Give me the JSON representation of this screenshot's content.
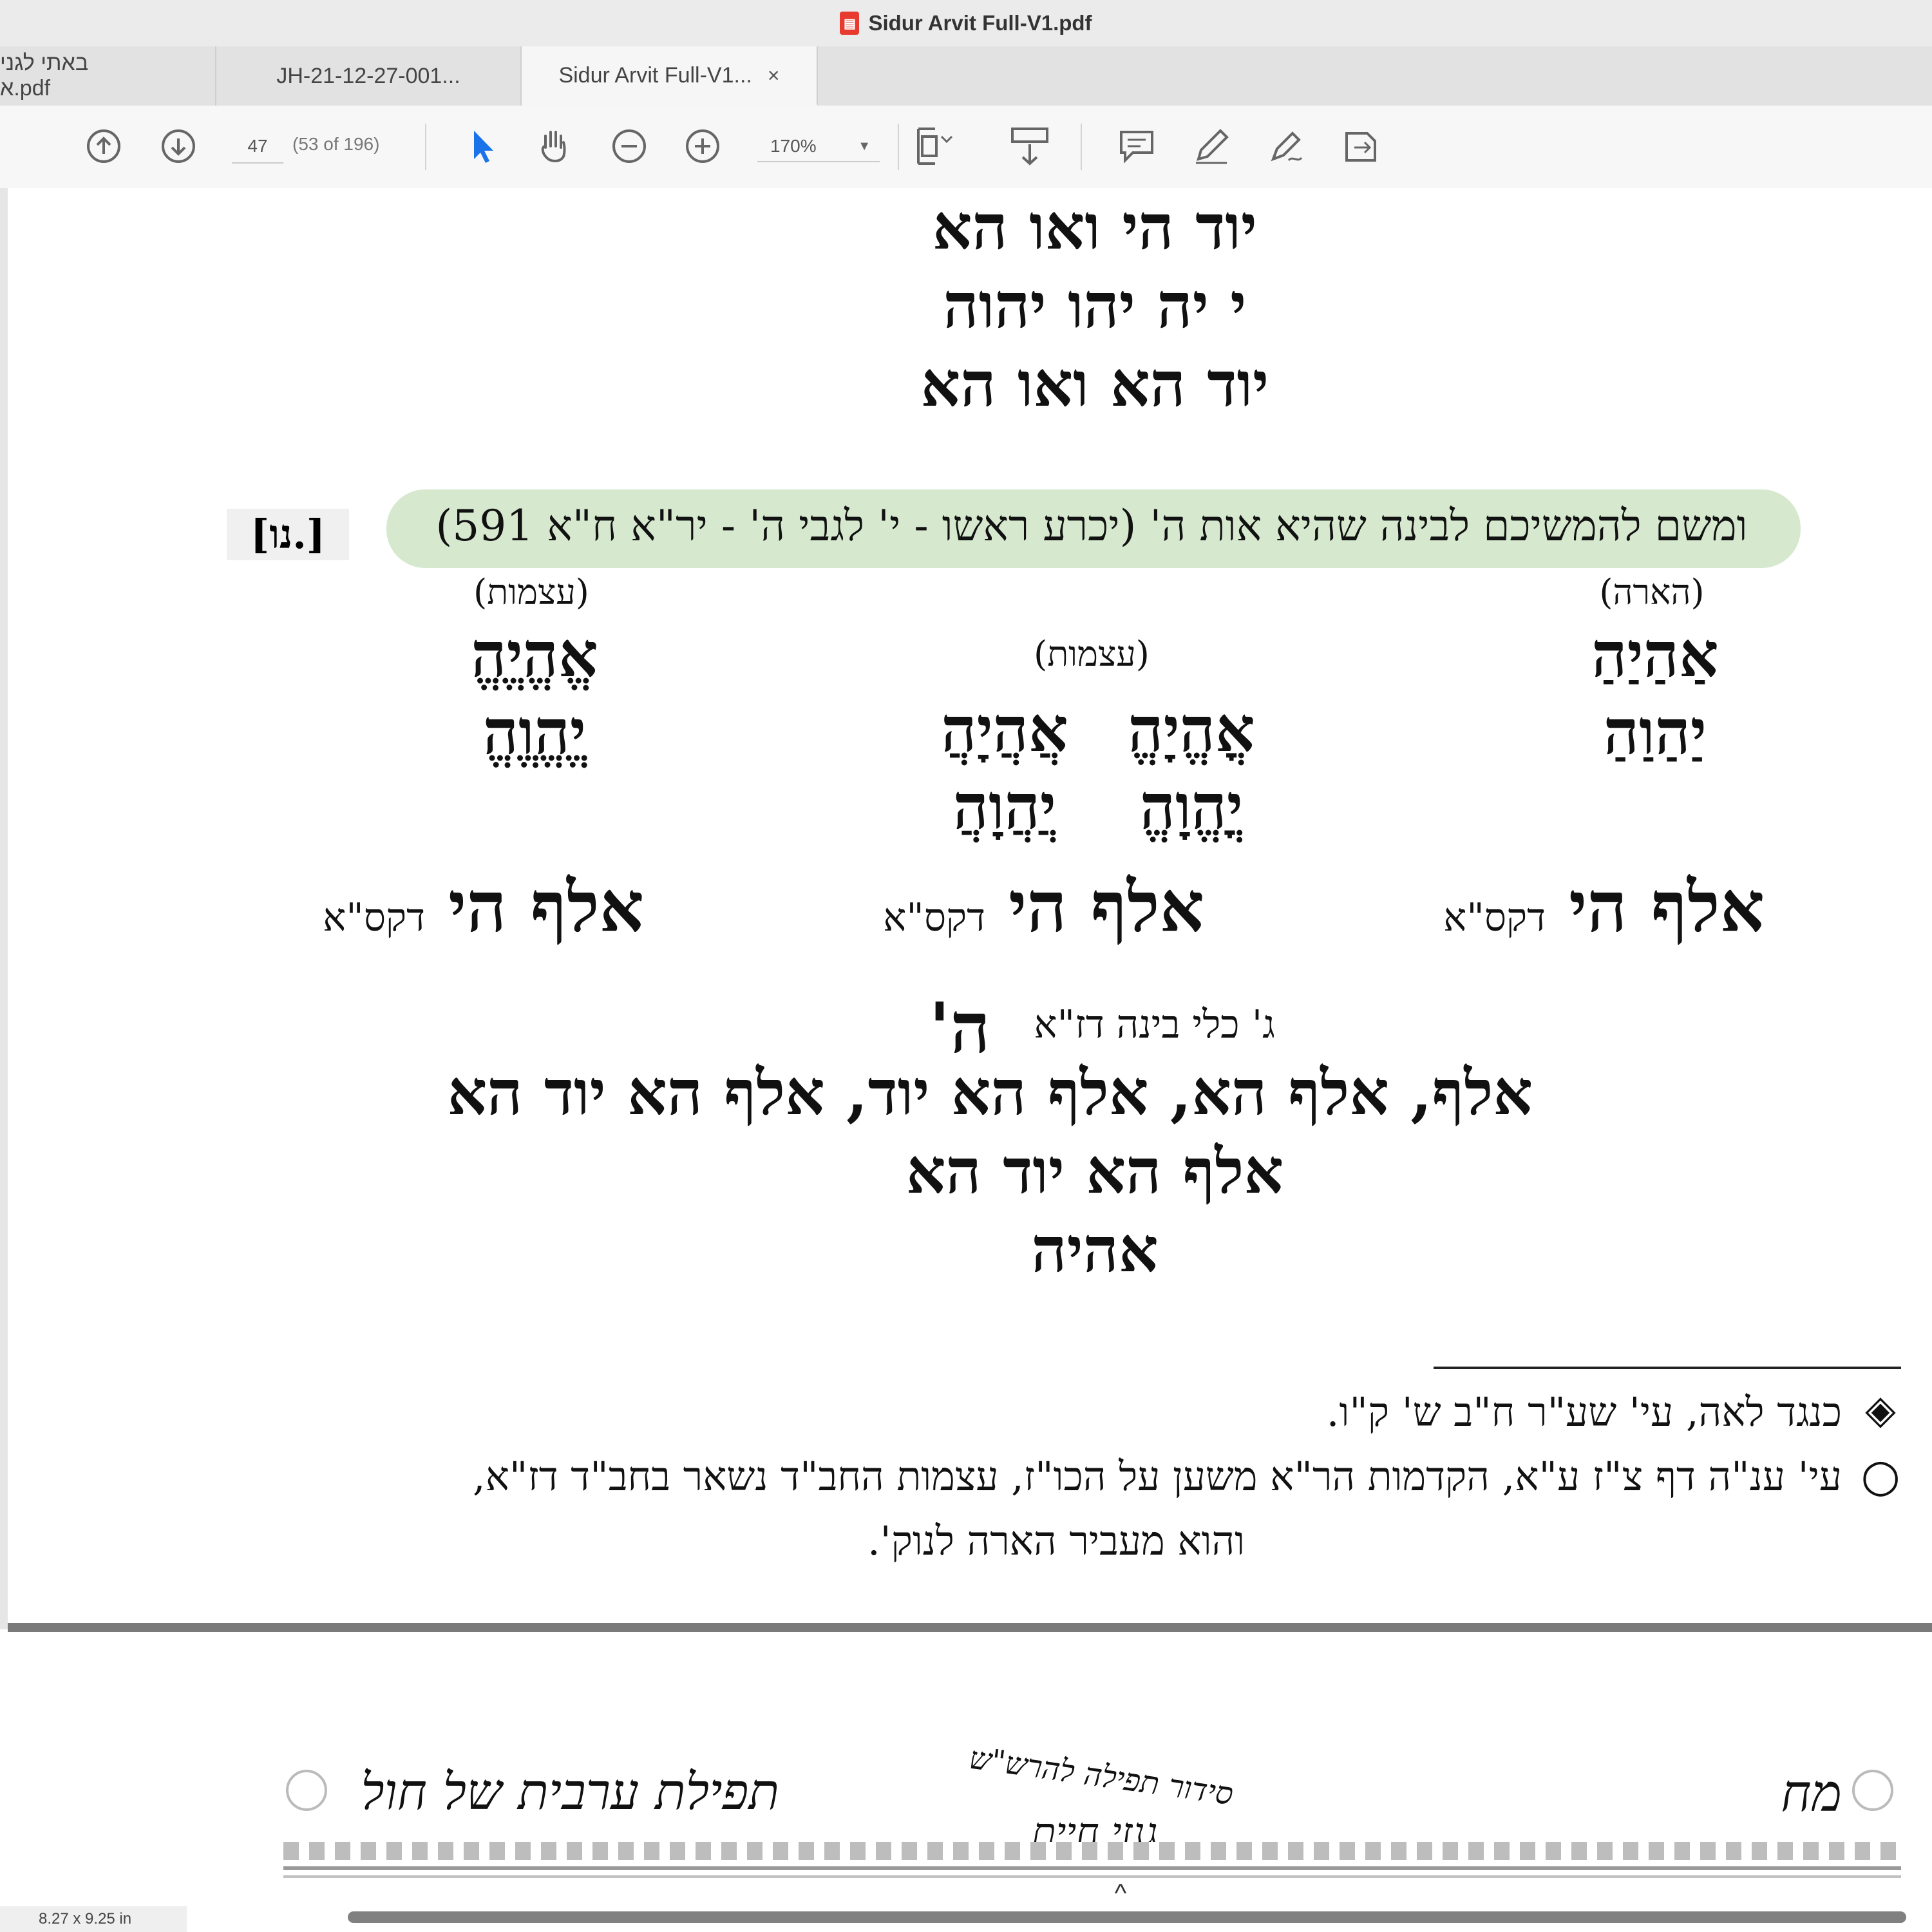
{
  "window": {
    "title": "Sidur Arvit Full-V1.pdf"
  },
  "tabs": [
    {
      "label": "באתי לגני א.pdf"
    },
    {
      "label": "JH-21-12-27-001..."
    },
    {
      "label": "Sidur Arvit Full-V1...",
      "close": "×"
    }
  ],
  "toolbar": {
    "page_input": "47",
    "page_count": "(53 of 196)",
    "zoom": "170%",
    "icons": [
      "prev-page-icon",
      "next-page-icon",
      "select-pointer-icon",
      "hand-tool-icon",
      "zoom-out-icon",
      "zoom-in-icon",
      "page-fit-icon",
      "scroll-mode-icon",
      "comment-icon",
      "pen-icon",
      "sign-icon",
      "share-icon"
    ]
  },
  "content": {
    "top_lines": [
      "יוד הי ואו הא",
      "י יה יהו יהוה",
      "יוד הא ואו הא"
    ],
    "banner_text": "ומשם להמשיכם לבינה שהיא אות ה' (יכרע ראשו - י' לגבי ה' - יר\"א ח\"א 591)",
    "section_marker": "[נו.]",
    "col_right": {
      "label": "(הארה)",
      "line1": "אַהַיַהַ",
      "line2": "יַהַוַהַ"
    },
    "col_left": {
      "label": "(עצמות)",
      "line1": "אֱהֱיֱהֱ",
      "line2": "יֱהֱוֱהֱ"
    },
    "col_middle": {
      "label": "(עצמות)",
      "a1": "אֲהֲיָהֲ",
      "a2": "יֲהֲוָהֲ",
      "b1": "אֳהֱיָהֱ",
      "b2": "יֳהֱוָהֱ"
    },
    "alef_row": {
      "big": "אלף הי",
      "small": "דקס\"א"
    },
    "kli_line_small": "ג' כלי בינה דז\"א",
    "kli_line_big": "ה'",
    "line_a": "אלף, אלף הא, אלף הא יוד, אלף הא יוד הא",
    "line_b": "אלף הא יוד הא",
    "line_c": "אהיה",
    "footnotes": [
      {
        "symbol": "◈",
        "text": "כנגד לאה, עי' שע\"ר ח\"ב ש' ק\"ו."
      },
      {
        "symbol": "○",
        "text": "עי' ענ\"ה דף צ\"ז ע\"א, הקדמות הר\"א משען על הכו\"ז, עצמות החב\"ד נשאר בחב\"ד דז\"א,"
      },
      {
        "symbol": "",
        "text": "והוא מעביר הארה לנוק'."
      }
    ]
  },
  "footer": {
    "left_text": "תפילת ערבית של חול",
    "center_top": "סידור תפילה להרש\"ש",
    "center_bottom": "גנזי חיים",
    "right_text": "מח",
    "page_mark": "^"
  },
  "status": {
    "page_size": "8.27 x 9.25 in"
  },
  "colors": {
    "banner": "#d6e9cf",
    "pdf_icon": "#e63b2e",
    "accent": "#1a73e8"
  }
}
